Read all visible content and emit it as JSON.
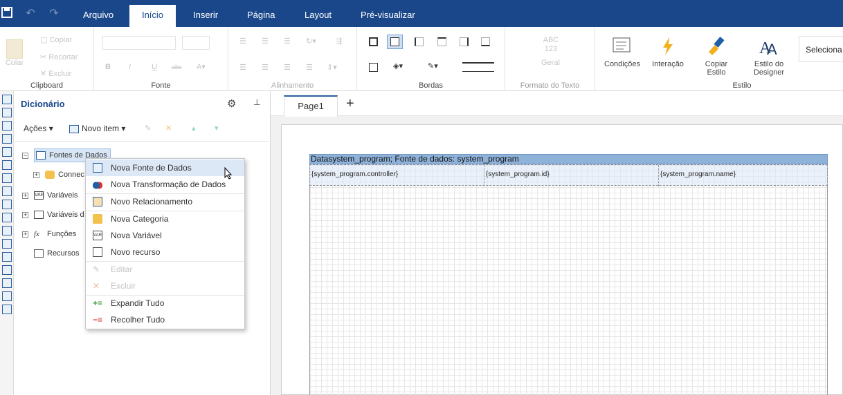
{
  "tabs": [
    "Arquivo",
    "Início",
    "Inserir",
    "Página",
    "Layout",
    "Pré-visualizar"
  ],
  "active_tab": "Início",
  "ribbon": {
    "clipboard": {
      "label": "Clipboard",
      "colar": "Colar",
      "copiar": "Copiar",
      "recortar": "Recortar",
      "excluir": "Excluir"
    },
    "fonte": {
      "label": "Fonte"
    },
    "alinhamento": {
      "label": "Alinhamento"
    },
    "bordas": {
      "label": "Bordas"
    },
    "formato": {
      "label": "Formato do Texto",
      "geral": "Geral",
      "sample": "ABC 123"
    },
    "estilo": {
      "label": "Estilo",
      "condicoes": "Condições",
      "interacao": "Interação",
      "copiar_estilo": "Copiar Estilo",
      "estilo_designer": "Estilo do Designer",
      "selecionar": "Seleciona"
    }
  },
  "dictionary": {
    "title": "Dicionário",
    "acoes": "Ações",
    "novo_item": "Novo item",
    "tree": {
      "fontes": "Fontes de Dados",
      "connection": "Connec",
      "variaveis": "Variáveis",
      "variaveis2": "Variáveis d",
      "funcoes": "Funções",
      "recursos": "Recursos"
    }
  },
  "context_menu": [
    {
      "label": "Nova Fonte de Dados",
      "enabled": true,
      "hover": true
    },
    {
      "label": "Nova Transformação de Dados",
      "enabled": true
    },
    {
      "label": "Novo Relacionamento",
      "enabled": true
    },
    {
      "label": "Nova Categoria",
      "enabled": true
    },
    {
      "label": "Nova Variável",
      "enabled": true
    },
    {
      "label": "Novo recurso",
      "enabled": true
    },
    {
      "label": "Editar",
      "enabled": false
    },
    {
      "label": "Excluir",
      "enabled": false
    },
    {
      "label": "Expandir Tudo",
      "enabled": true
    },
    {
      "label": "Recolher Tudo",
      "enabled": true
    }
  ],
  "page_tab": "Page1",
  "report": {
    "band_header": "Datasystem_program; Fonte de dados: system_program",
    "cells": [
      "{system_program.controller}",
      "{system_program.id}",
      "{system_program.name}"
    ]
  },
  "colors": {
    "topbar": "#19478a",
    "accent": "#2a5e9c",
    "band": "#8fb2d8"
  }
}
